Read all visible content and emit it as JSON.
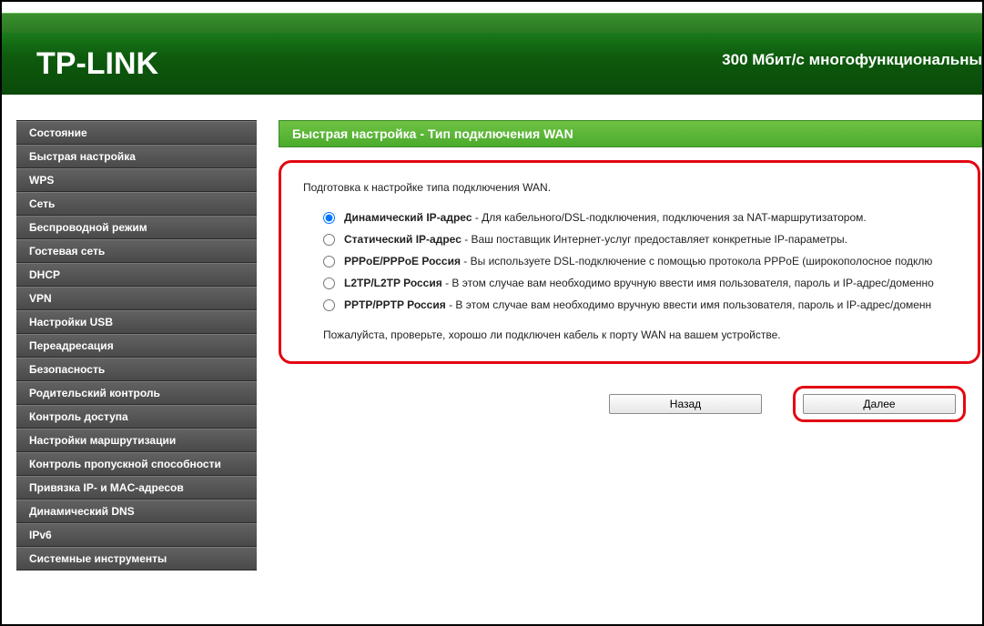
{
  "brand": "TP-LINK",
  "tagline": "300 Мбит/с многофункциональны",
  "nav": {
    "items": [
      "Состояние",
      "Быстрая настройка",
      "WPS",
      "Сеть",
      "Беспроводной режим",
      "Гостевая сеть",
      "DHCP",
      "VPN",
      "Настройки USB",
      "Переадресация",
      "Безопасность",
      "Родительский контроль",
      "Контроль доступа",
      "Настройки маршрутизации",
      "Контроль пропускной способности",
      "Привязка IP- и MAC-адресов",
      "Динамический DNS",
      "IPv6",
      "Системные инструменты"
    ]
  },
  "page": {
    "title": "Быстрая настройка - Тип подключения WAN",
    "intro": "Подготовка к настройке типа подключения WAN.",
    "options": [
      {
        "label": "Динамический IP-адрес",
        "desc": " - Для кабельного/DSL-подключения, подключения за NAT-маршрутизатором.",
        "checked": true
      },
      {
        "label": "Статический IP-адрес",
        "desc": " - Ваш поставщик Интернет-услуг предоставляет конкретные IP-параметры.",
        "checked": false
      },
      {
        "label": "PPPoE/PPPoE Россия",
        "desc": " - Вы используете DSL-подключение с помощью протокола PPPoE (широкополосное подклю",
        "checked": false
      },
      {
        "label": "L2TP/L2TP Россия",
        "desc": " - В этом случае вам необходимо вручную ввести имя пользователя, пароль и IP-адрес/доменно",
        "checked": false
      },
      {
        "label": "PPTP/PPTP Россия",
        "desc": " - В этом случае вам необходимо вручную ввести имя пользователя, пароль и IP-адрес/доменн",
        "checked": false
      }
    ],
    "note": "Пожалуйста, проверьте, хорошо ли подключен кабель к порту WAN на вашем устройстве.",
    "back_label": "Назад",
    "next_label": "Далее"
  }
}
